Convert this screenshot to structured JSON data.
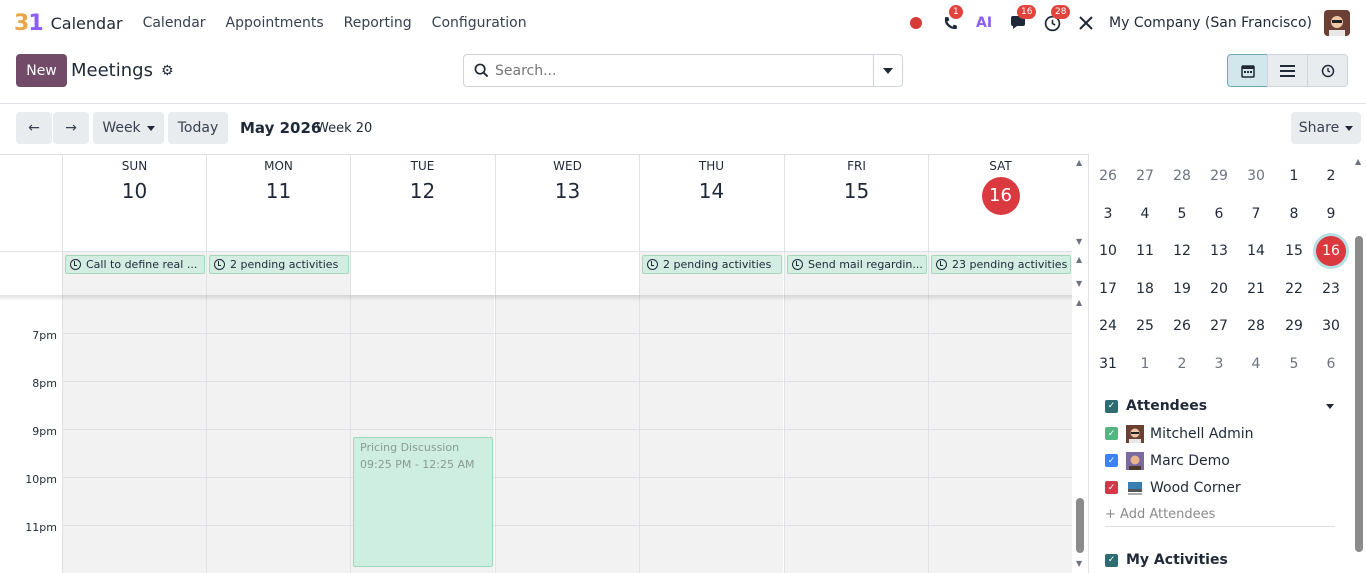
{
  "navbar": {
    "app_logo": "31",
    "app_name": "Calendar",
    "menu": [
      "Calendar",
      "Appointments",
      "Reporting",
      "Configuration"
    ],
    "phone_badge": "1",
    "ai_label": "AI",
    "messages_badge": "16",
    "activities_badge": "28",
    "company": "My Company (San Francisco)",
    "colors": {
      "badge": "#e0443d",
      "record": "#d63b35"
    }
  },
  "control": {
    "new_label": "New",
    "breadcrumb": "Meetings",
    "search_placeholder": "Search...",
    "views": [
      "calendar-icon",
      "list-icon",
      "activity-icon"
    ]
  },
  "toolbar": {
    "prev": "←",
    "next": "→",
    "scale": "Week",
    "today": "Today",
    "range_title": "May 2026",
    "week_label": "Week 20",
    "share": "Share"
  },
  "days": [
    {
      "name": "SUN",
      "num": "10"
    },
    {
      "name": "MON",
      "num": "11"
    },
    {
      "name": "TUE",
      "num": "12"
    },
    {
      "name": "WED",
      "num": "13"
    },
    {
      "name": "THU",
      "num": "14"
    },
    {
      "name": "FRI",
      "num": "15"
    },
    {
      "name": "SAT",
      "num": "16",
      "today": true
    }
  ],
  "allday": [
    {
      "day": 0,
      "text": "Call to define real ..."
    },
    {
      "day": 1,
      "text": "2 pending activities"
    },
    {
      "day": 4,
      "text": "2 pending activities"
    },
    {
      "day": 5,
      "text": "Send mail regardin..."
    },
    {
      "day": 6,
      "text": "23 pending activities"
    }
  ],
  "hours": [
    "7pm",
    "8pm",
    "9pm",
    "10pm",
    "11pm"
  ],
  "event": {
    "title": "Pricing Discussion",
    "time": "09:25 PM - 12:25 AM",
    "day": 2
  },
  "mini_calendar": [
    [
      "26",
      "27",
      "28",
      "29",
      "30",
      "1",
      "2"
    ],
    [
      "3",
      "4",
      "5",
      "6",
      "7",
      "8",
      "9"
    ],
    [
      "10",
      "11",
      "12",
      "13",
      "14",
      "15",
      "16"
    ],
    [
      "17",
      "18",
      "19",
      "20",
      "21",
      "22",
      "23"
    ],
    [
      "24",
      "25",
      "26",
      "27",
      "28",
      "29",
      "30"
    ],
    [
      "31",
      "1",
      "2",
      "3",
      "4",
      "5",
      "6"
    ]
  ],
  "attendees": {
    "title": "Attendees",
    "items": [
      {
        "name": "Mitchell Admin",
        "color": "#54b582"
      },
      {
        "name": "Marc Demo",
        "color": "#3b82f6"
      },
      {
        "name": "Wood Corner",
        "color": "#d0394a"
      }
    ],
    "add_label": "+ Add Attendees"
  },
  "my_activities": {
    "title": "My Activities"
  }
}
